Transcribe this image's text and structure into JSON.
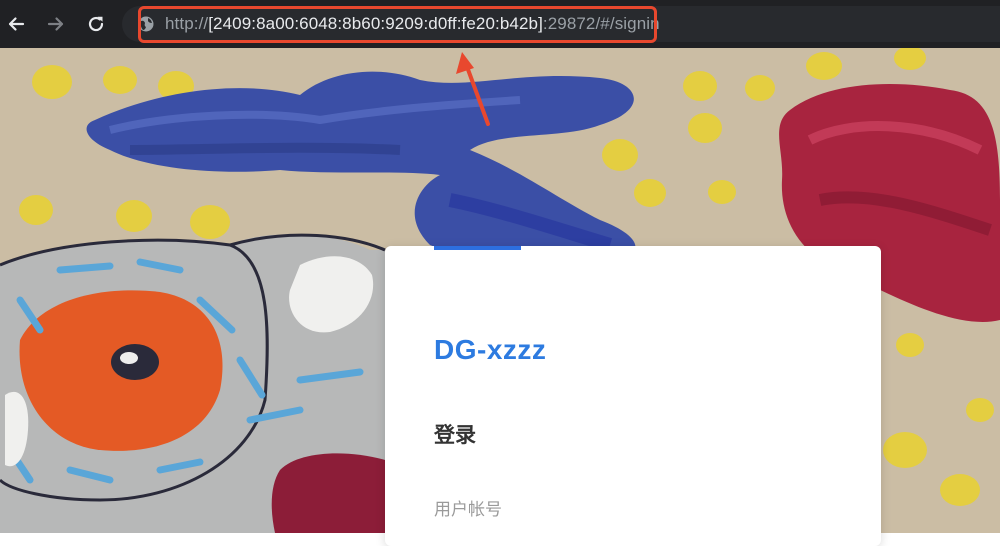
{
  "browser": {
    "back_icon": "arrow-left-icon",
    "forward_icon": "arrow-right-icon",
    "reload_icon": "reload-icon",
    "site_icon": "globe-icon",
    "url": {
      "scheme": "http://",
      "host": "[2409:8a00:6048:8b60:9209:d0ff:fe20:b42b]",
      "port_path": ":29872/#/signin"
    },
    "highlight_color": "#e8482e"
  },
  "login_card": {
    "app_name": "DG-xzzz",
    "heading": "登录",
    "account_label": "用户帐号",
    "accent_color": "#2d6fe0",
    "title_color": "#2d7be0"
  }
}
